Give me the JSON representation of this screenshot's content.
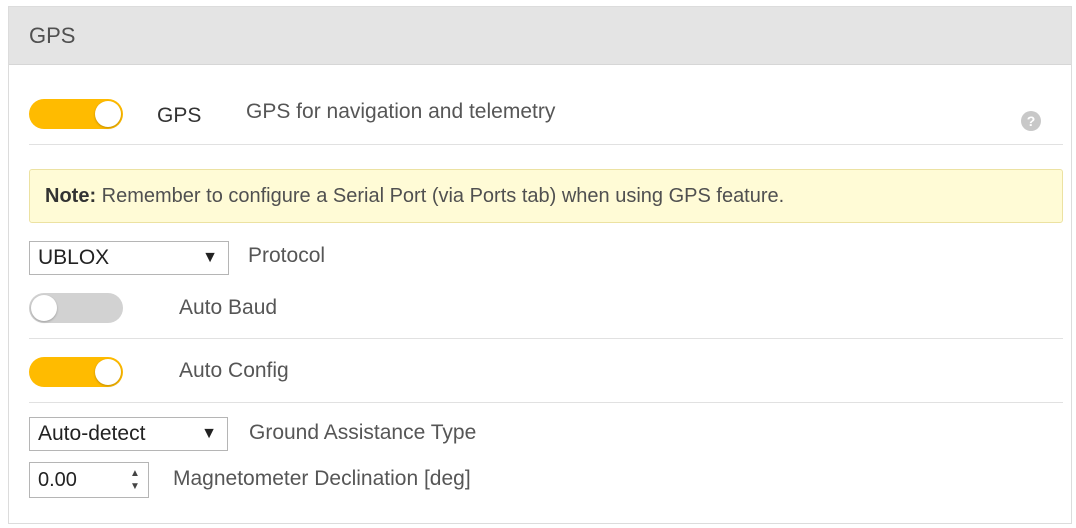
{
  "panel": {
    "title": "GPS"
  },
  "gps_feature": {
    "toggle_state": "on",
    "name": "GPS",
    "description": "GPS for navigation and telemetry",
    "help_icon": "question-circle-icon"
  },
  "note": {
    "label": "Note:",
    "text": " Remember to configure a Serial Port (via Ports tab) when using GPS feature."
  },
  "protocol": {
    "value": "UBLOX",
    "label": "Protocol"
  },
  "auto_baud": {
    "toggle_state": "off",
    "label": "Auto Baud"
  },
  "auto_config": {
    "toggle_state": "on",
    "label": "Auto Config"
  },
  "ground_assistance": {
    "value": "Auto-detect",
    "label": "Ground Assistance Type"
  },
  "mag_declination": {
    "value": "0.00",
    "label": "Magnetometer Declination [deg]"
  },
  "colors": {
    "accent": "#ffbb00",
    "toggle_off": "#d2d2d2",
    "note_bg": "#fffbd6"
  }
}
